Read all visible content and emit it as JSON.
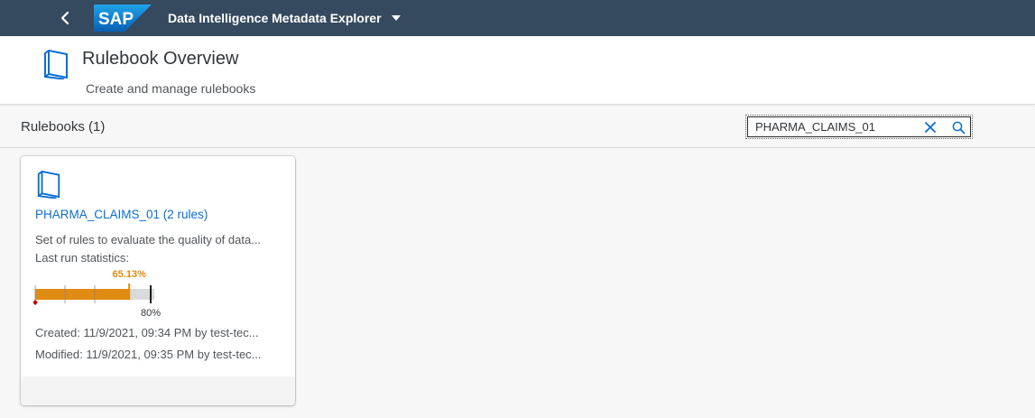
{
  "shell": {
    "logo_text": "SAP",
    "app_title": "Data Intelligence Metadata Explorer"
  },
  "header": {
    "title": "Rulebook Overview",
    "subtitle": "Create and manage rulebooks"
  },
  "toolbar": {
    "count_label": "Rulebooks (1)",
    "search_value": "PHARMA_CLAIMS_01"
  },
  "rulebooks": [
    {
      "title": "PHARMA_CLAIMS_01 (2 rules)",
      "description": "Set of rules to evaluate the quality of data...",
      "stats_label": "Last run statistics:",
      "score_label": "65.13%",
      "score_value": 65.13,
      "threshold_label": "80%",
      "threshold_value": 80,
      "created": "Created: 11/9/2021, 09:34 PM by test-tec...",
      "modified": "Modified: 11/9/2021, 09:35 PM by test-tec..."
    }
  ],
  "colors": {
    "shell_bg": "#354a5f",
    "link": "#0a6ed1",
    "bar_fill": "#e08b12",
    "bar_track": "#d9dadb",
    "logo_blue": "#0a73c7"
  },
  "icons": {
    "back": "chevron-left-icon",
    "caret": "caret-down-icon",
    "rulebook": "book-icon",
    "clear": "close-icon",
    "search": "search-icon"
  }
}
